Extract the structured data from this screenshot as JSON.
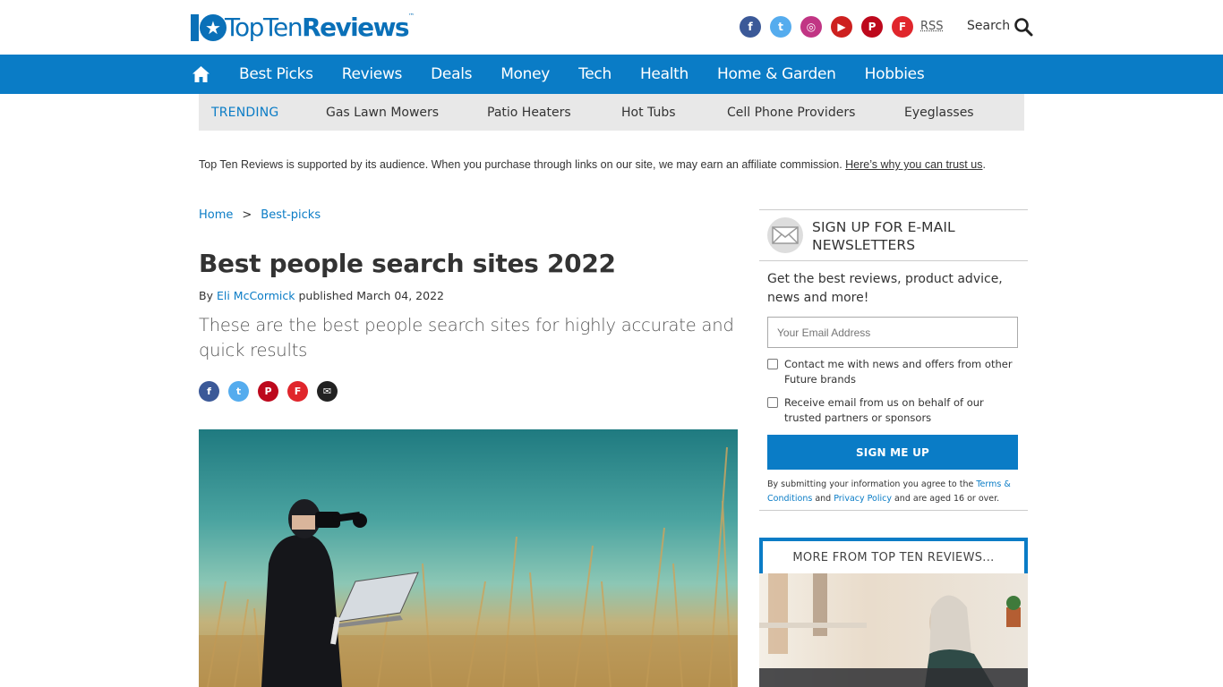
{
  "header": {
    "logo": {
      "prefix": "10",
      "light": "TopTen",
      "bold": "Reviews",
      "tm": "™"
    },
    "social": [
      {
        "name": "facebook-icon",
        "glyph": "f"
      },
      {
        "name": "twitter-icon",
        "glyph": "t"
      },
      {
        "name": "instagram-icon",
        "glyph": "◎"
      },
      {
        "name": "youtube-icon",
        "glyph": "▶"
      },
      {
        "name": "pinterest-icon",
        "glyph": "P"
      },
      {
        "name": "flipboard-icon",
        "glyph": "F"
      }
    ],
    "rss": "RSS",
    "search_label": "Search"
  },
  "nav": {
    "items": [
      "Best Picks",
      "Reviews",
      "Deals",
      "Money",
      "Tech",
      "Health",
      "Home & Garden",
      "Hobbies"
    ]
  },
  "trending": {
    "label": "TRENDING",
    "items": [
      "Gas Lawn Mowers",
      "Patio Heaters",
      "Hot Tubs",
      "Cell Phone Providers",
      "Eyeglasses"
    ]
  },
  "affiliate": {
    "text": "Top Ten Reviews is supported by its audience. When you purchase through links on our site, we may earn an affiliate commission. ",
    "link": "Here’s why you can trust us",
    "end": "."
  },
  "breadcrumb": {
    "home": "Home",
    "sep": ">",
    "current": "Best-picks"
  },
  "article": {
    "title": "Best people search sites 2022",
    "by": "By",
    "author": "Eli McCormick",
    "published": "published March 04, 2022",
    "strap": "These are the best people search sites for highly accurate and quick results"
  },
  "share": [
    {
      "name": "share-facebook-icon",
      "glyph": "f"
    },
    {
      "name": "share-twitter-icon",
      "glyph": "t"
    },
    {
      "name": "share-pinterest-icon",
      "glyph": "P"
    },
    {
      "name": "share-flipboard-icon",
      "glyph": "F"
    },
    {
      "name": "share-email-icon",
      "glyph": "✉"
    }
  ],
  "newsletter": {
    "title": "SIGN UP FOR E-MAIL NEWSLETTERS",
    "desc": "Get the best reviews, product advice, news and more!",
    "placeholder": "Your Email Address",
    "check1": "Contact me with news and offers from other Future brands",
    "check2": "Receive email from us on behalf of our trusted partners or sponsors",
    "button": "SIGN ME UP",
    "legal1": "By submitting your information you agree to the ",
    "terms": "Terms & Conditions",
    "legal2": " and ",
    "privacy": "Privacy Policy",
    "legal3": " and are aged 16 or over."
  },
  "more": {
    "title": "MORE FROM TOP TEN REVIEWS..."
  },
  "colors": {
    "brand": "#0a7cc6",
    "trending_bg": "#e8e8e8"
  }
}
